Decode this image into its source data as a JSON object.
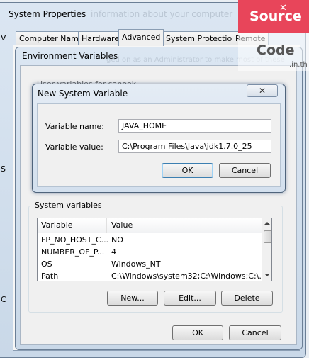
{
  "system_properties": {
    "title": "System Properties",
    "bg_line1": "information about your computer",
    "bg_line2": "ged on as an Administrator to make most of these",
    "tabs": [
      "Computer Name",
      "Hardware",
      "Advanced",
      "System Protection",
      "Remote"
    ],
    "active_tab": "Advanced",
    "left_edge_letters": [
      "V",
      "S",
      "C"
    ]
  },
  "env_vars": {
    "title": "Environment Variables",
    "user_vars_label": "User variables for sanook",
    "system_vars_label": "System variables",
    "columns": [
      "Variable",
      "Value"
    ],
    "rows": [
      {
        "variable": "FP_NO_HOST_C...",
        "value": "NO"
      },
      {
        "variable": "NUMBER_OF_P...",
        "value": "4"
      },
      {
        "variable": "OS",
        "value": "Windows_NT"
      },
      {
        "variable": "Path",
        "value": "C:\\Windows\\system32;C:\\Windows;C:\\..."
      }
    ],
    "new_label": "New...",
    "edit_label": "Edit...",
    "delete_label": "Delete",
    "ok_label": "OK",
    "cancel_label": "Cancel"
  },
  "new_sysvar": {
    "title": "New System Variable",
    "name_label": "Variable name:",
    "name_value": "JAVA_HOME",
    "value_label": "Variable value:",
    "value_value": "C:\\Program Files\\Java\\jdk1.7.0_25",
    "ok_label": "OK",
    "cancel_label": "Cancel"
  },
  "watermark": {
    "line1": "Source",
    "line2": "Code",
    "line3": ".in.th",
    "color": "#e8455a"
  },
  "colors": {
    "accent_border": "#6b7f96",
    "glass": "#d3e0ee"
  }
}
